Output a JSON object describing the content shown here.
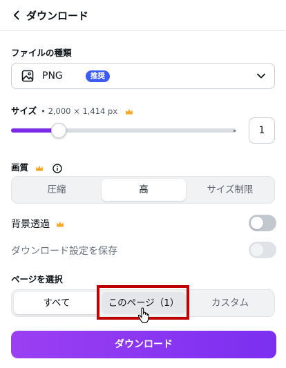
{
  "header": {
    "title": "ダウンロード"
  },
  "file_type": {
    "label": "ファイルの種類",
    "value": "PNG",
    "badge": "推奨"
  },
  "size": {
    "label": "サイズ",
    "dimensions": "• 2,000 × 1,414 px",
    "slider_fraction": 0.21,
    "value": "1"
  },
  "quality": {
    "label": "画質",
    "options": [
      "圧縮",
      "高",
      "サイズ制限"
    ],
    "selected": "高"
  },
  "transparent_bg": {
    "label": "背景透過",
    "on": false
  },
  "save_settings": {
    "label": "ダウンロード設定を保存",
    "on": false,
    "disabled": true
  },
  "pages": {
    "label": "ページを選択",
    "options": [
      "すべて",
      "このページ（1）",
      "カスタム"
    ],
    "selected": "すべて",
    "hovered": "このページ（1）"
  },
  "download_button": {
    "label": "ダウンロード"
  },
  "colors": {
    "accent": "#7d2ae8",
    "badge": "#3d5cf5",
    "crown": "#f5a623",
    "highlight": "#c00000"
  },
  "icons": [
    "chevron-left-icon",
    "image-icon",
    "chevron-down-icon",
    "crown-icon",
    "info-icon",
    "hand-cursor-icon"
  ]
}
